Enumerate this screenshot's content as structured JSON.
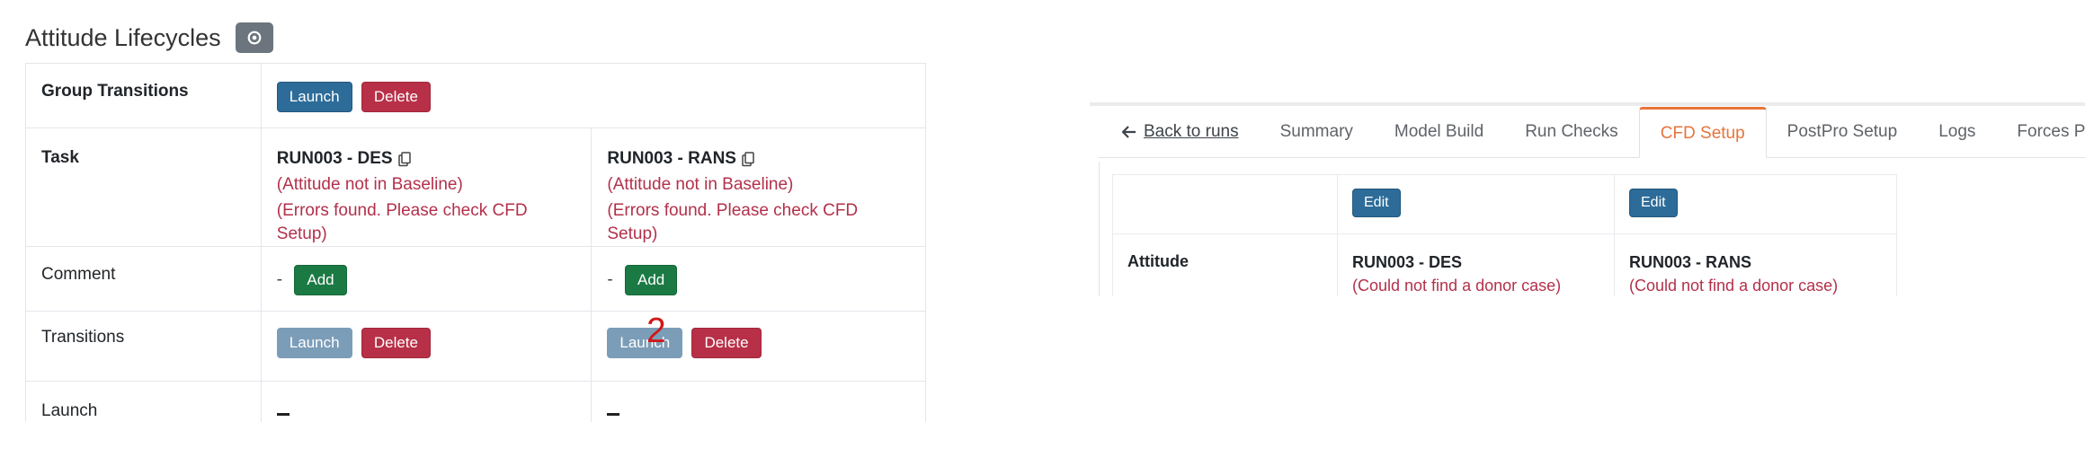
{
  "left": {
    "title": "Attitude Lifecycles",
    "settings_icon": "gear-icon",
    "rows": {
      "group_transitions": {
        "label": "Group Transitions",
        "launch": "Launch",
        "delete": "Delete"
      },
      "task": {
        "label": "Task",
        "col1": {
          "name": "RUN003 - DES",
          "err1": "(Attitude not in Baseline)",
          "err2": "(Errors found. Please check CFD Setup)"
        },
        "col2": {
          "name": "RUN003 - RANS",
          "err1": "(Attitude not in Baseline)",
          "err2": "(Errors found. Please check CFD Setup)"
        }
      },
      "comment": {
        "label": "Comment",
        "dash": "-",
        "add": "Add"
      },
      "transitions": {
        "label": "Transitions",
        "launch": "Launch",
        "delete": "Delete"
      },
      "launch": {
        "label": "Launch"
      }
    },
    "overlay_number": "2"
  },
  "right": {
    "tabs": {
      "back": "Back to runs",
      "summary": "Summary",
      "model_build": "Model Build",
      "run_checks": "Run Checks",
      "cfd_setup": "CFD Setup",
      "postpro_setup": "PostPro Setup",
      "logs": "Logs",
      "forces_plot": "Forces Plot"
    },
    "active_tab": "CFD Setup",
    "table": {
      "edit": "Edit",
      "attitude_label": "Attitude",
      "col1": {
        "name": "RUN003 - DES",
        "err": "(Could not find a donor case)"
      },
      "col2": {
        "name": "RUN003 - RANS",
        "err": "(Could not find a donor case)"
      }
    }
  },
  "colors": {
    "primary": "#2d6c99",
    "danger": "#b73047",
    "success": "#1b7a44",
    "error_text": "#b3304a",
    "active_tab": "#e7743b"
  }
}
